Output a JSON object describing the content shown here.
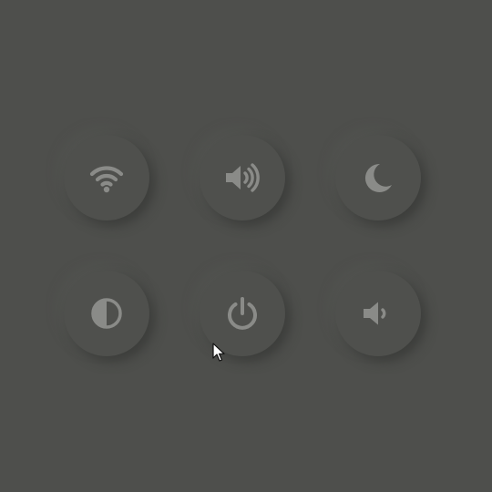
{
  "theme": {
    "background": "#4e4f4c",
    "button": "#4f504d",
    "icon": "#8a8b88"
  },
  "controls": [
    {
      "name": "wifi",
      "icon": "wifi-icon"
    },
    {
      "name": "volume-up",
      "icon": "volume-up-icon"
    },
    {
      "name": "night-mode",
      "icon": "moon-icon"
    },
    {
      "name": "contrast",
      "icon": "contrast-icon"
    },
    {
      "name": "power",
      "icon": "power-icon"
    },
    {
      "name": "volume-down",
      "icon": "volume-low-icon"
    }
  ],
  "cursor": {
    "icon": "mouse-pointer-icon"
  }
}
